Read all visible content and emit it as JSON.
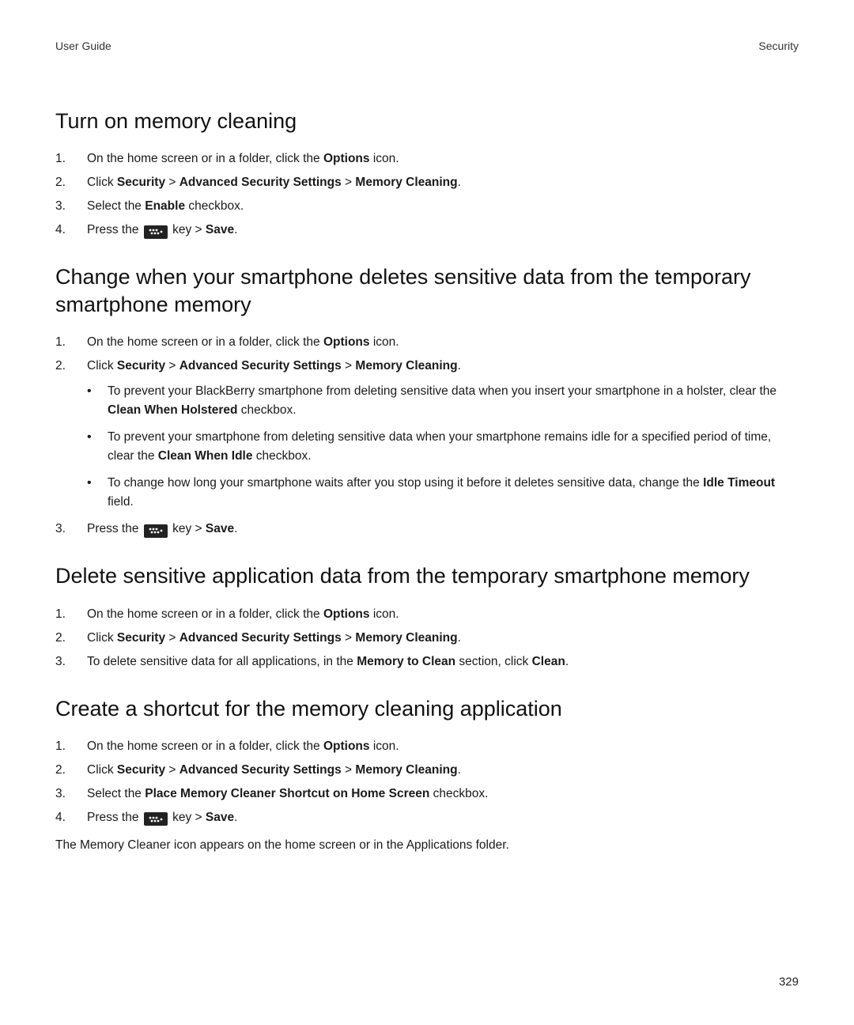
{
  "header": {
    "left": "User Guide",
    "right": "Security"
  },
  "page_number": "329",
  "s1": {
    "title": "Turn on memory cleaning",
    "step1_a": "On the home screen or in a folder, click the ",
    "step1_b": "Options",
    "step1_c": " icon.",
    "step2_a": "Click ",
    "step2_b": "Security",
    "step2_c": " > ",
    "step2_d": "Advanced Security Settings",
    "step2_e": " > ",
    "step2_f": "Memory Cleaning",
    "step2_g": ".",
    "step3_a": "Select the ",
    "step3_b": "Enable",
    "step3_c": " checkbox.",
    "step4_a": "Press the ",
    "step4_b": " key > ",
    "step4_c": "Save",
    "step4_d": "."
  },
  "s2": {
    "title": "Change when your smartphone deletes sensitive data from the temporary smartphone memory",
    "step1_a": "On the home screen or in a folder, click the ",
    "step1_b": "Options",
    "step1_c": " icon.",
    "step2_a": "Click ",
    "step2_b": "Security",
    "step2_c": " > ",
    "step2_d": "Advanced Security Settings",
    "step2_e": " > ",
    "step2_f": "Memory Cleaning",
    "step2_g": ".",
    "b1_a": "To prevent your BlackBerry smartphone from deleting sensitive data when you insert your smartphone in a holster, clear the ",
    "b1_b": "Clean When Holstered",
    "b1_c": " checkbox.",
    "b2_a": "To prevent your smartphone from deleting sensitive data when your smartphone remains idle for a specified period of time, clear the ",
    "b2_b": "Clean When Idle",
    "b2_c": " checkbox.",
    "b3_a": "To change how long your smartphone waits after you stop using it before it deletes sensitive data, change the ",
    "b3_b": "Idle Timeout",
    "b3_c": " field.",
    "step3_a": "Press the ",
    "step3_b": " key > ",
    "step3_c": "Save",
    "step3_d": "."
  },
  "s3": {
    "title": "Delete sensitive application data from the temporary smartphone memory",
    "step1_a": "On the home screen or in a folder, click the ",
    "step1_b": "Options",
    "step1_c": " icon.",
    "step2_a": "Click ",
    "step2_b": "Security",
    "step2_c": " > ",
    "step2_d": "Advanced Security Settings",
    "step2_e": " > ",
    "step2_f": "Memory Cleaning",
    "step2_g": ".",
    "step3_a": "To delete sensitive data for all applications, in the ",
    "step3_b": "Memory to Clean",
    "step3_c": " section, click ",
    "step3_d": "Clean",
    "step3_e": "."
  },
  "s4": {
    "title": "Create a shortcut for the memory cleaning application",
    "step1_a": "On the home screen or in a folder, click the ",
    "step1_b": "Options",
    "step1_c": " icon.",
    "step2_a": "Click ",
    "step2_b": "Security",
    "step2_c": " > ",
    "step2_d": "Advanced Security Settings",
    "step2_e": " > ",
    "step2_f": "Memory Cleaning",
    "step2_g": ".",
    "step3_a": "Select the ",
    "step3_b": "Place Memory Cleaner Shortcut on Home Screen",
    "step3_c": " checkbox.",
    "step4_a": "Press the ",
    "step4_b": " key > ",
    "step4_c": "Save",
    "step4_d": ".",
    "note": "The Memory Cleaner icon appears on the home screen or in the Applications folder."
  }
}
